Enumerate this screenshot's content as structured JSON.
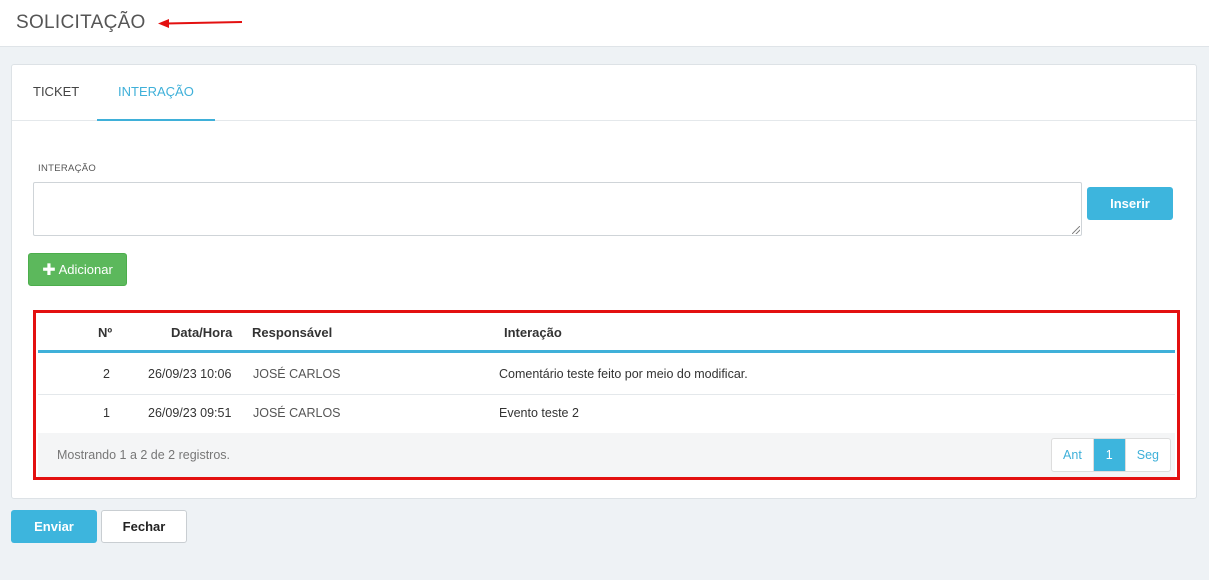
{
  "header": {
    "title": "SOLICITAÇÃO"
  },
  "tabs": [
    {
      "label": "TICKET",
      "active": false
    },
    {
      "label": "INTERAÇÃO",
      "active": true
    }
  ],
  "form": {
    "field_label": "INTERAÇÃO",
    "textarea_value": "",
    "insert_label": "Inserir",
    "add_label": "Adicionar"
  },
  "table": {
    "columns": [
      "Nº",
      "Data/Hora",
      "Responsável",
      "Interação"
    ],
    "rows": [
      {
        "num": "2",
        "datetime": "26/09/23 10:06",
        "responsible": "JOSÉ CARLOS",
        "interaction": "Comentário teste feito por meio do modificar."
      },
      {
        "num": "1",
        "datetime": "26/09/23 09:51",
        "responsible": "JOSÉ CARLOS",
        "interaction": "Evento teste 2"
      }
    ],
    "footer_info": "Mostrando 1 a 2 de 2 registros.",
    "pagination": {
      "prev": "Ant",
      "current": "1",
      "next": "Seg"
    }
  },
  "actions": {
    "send_label": "Enviar",
    "close_label": "Fechar"
  },
  "colors": {
    "accent": "#3db5dd",
    "success": "#5cb85c",
    "annotation": "#e31010"
  },
  "icons": {
    "add": "plus-icon",
    "annotation": "red-arrow-icon"
  }
}
